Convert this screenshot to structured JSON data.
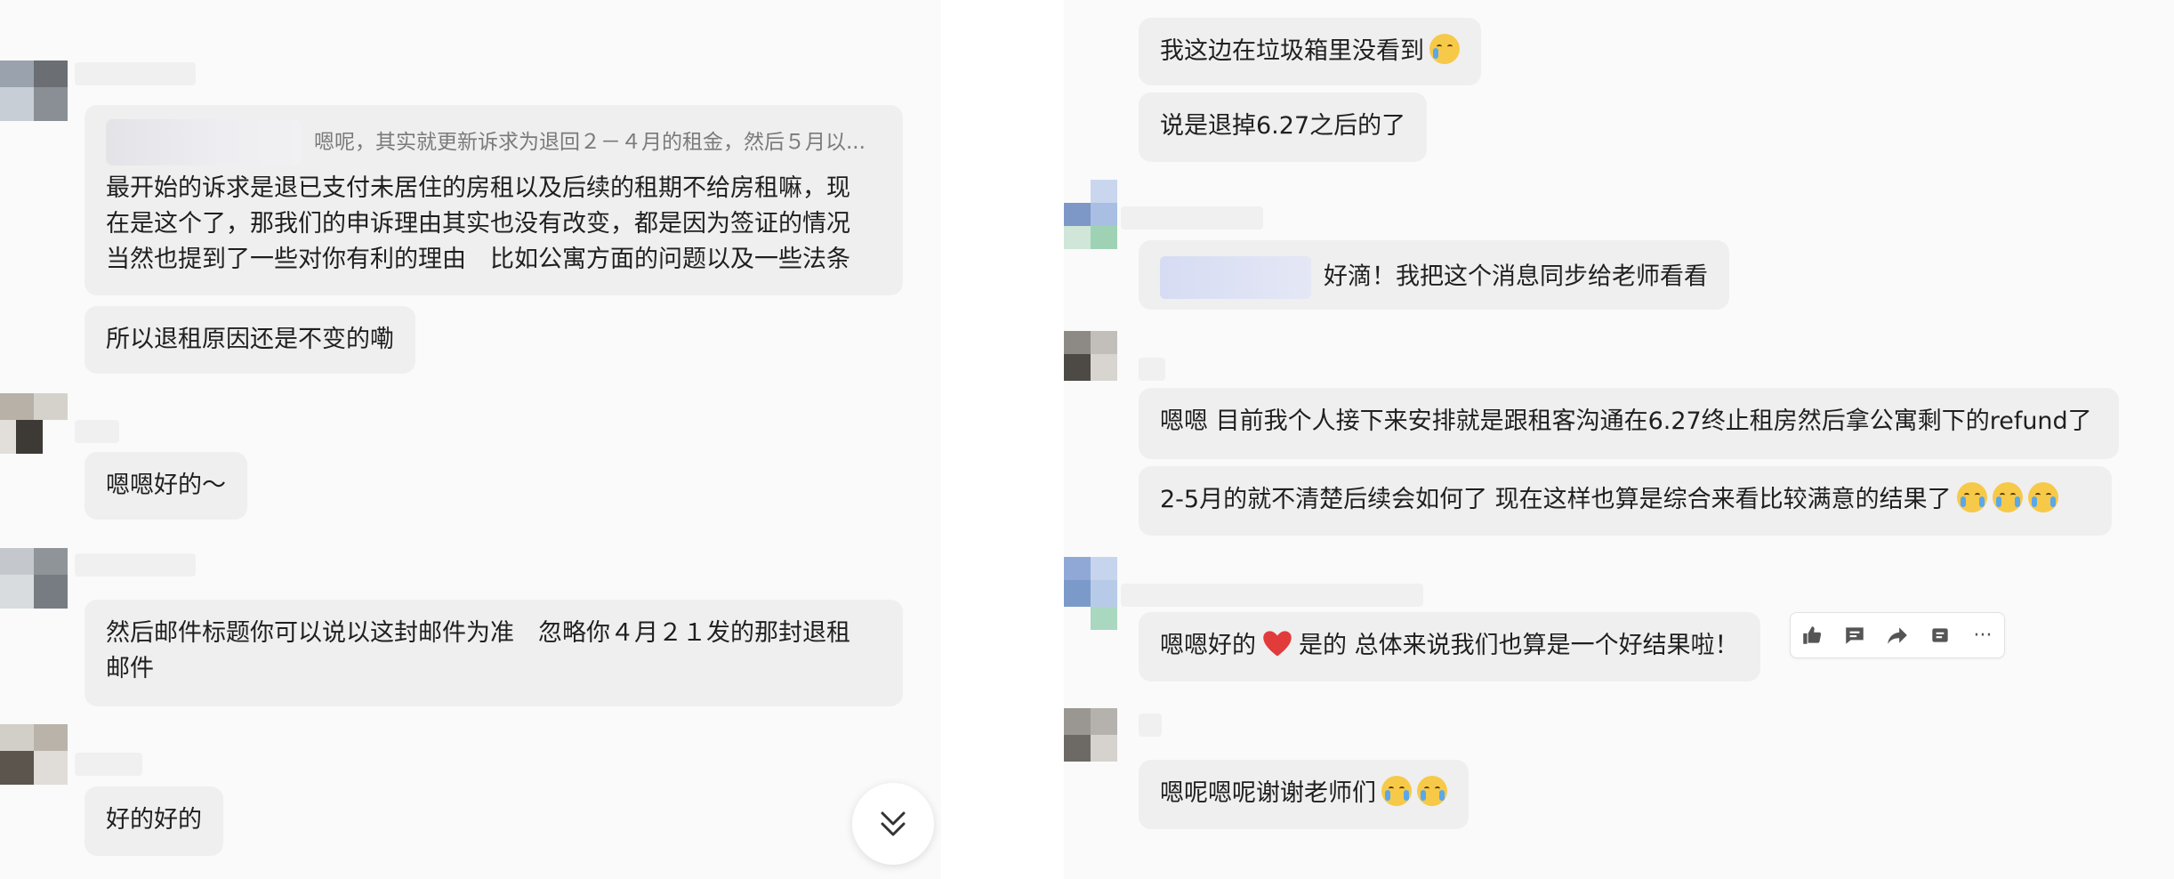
{
  "left": {
    "quote": {
      "text": "嗯呢，其实就更新诉求为退回２－４月的租金，然后５月以..."
    },
    "messages": [
      {
        "lines": [
          "最开始的诉求是退已支付未居住的房租以及后续的租期不给房租嘛，现",
          "在是这个了，那我们的申诉理由其实也没有改变，都是因为签证的情况",
          "当然也提到了一些对你有利的理由　比如公寓方面的问题以及一些法条"
        ]
      },
      {
        "text": "所以退租原因还是不变的嘞"
      },
      {
        "text": "嗯嗯好的～"
      },
      {
        "lines": [
          "然后邮件标题你可以说以这封邮件为准　忽略你４月２１发的那封退租",
          "邮件"
        ]
      },
      {
        "text": "好的好的"
      }
    ]
  },
  "right": {
    "messages": [
      {
        "text": "我这边在垃圾箱里没看到"
      },
      {
        "text": "说是退掉6.27之后的了"
      },
      {
        "text": "好滴！我把这个消息同步给老师看看"
      },
      {
        "text": "嗯嗯 目前我个人接下来安排就是跟租客沟通在6.27终止租房然后拿公寓剩下的refund了"
      },
      {
        "text": "2-5月的就不清楚后续会如何了 现在这样也算是综合来看比较满意的结果了"
      },
      {
        "part1": "嗯嗯好的",
        "part2": "是的 总体来说我们也算是一个好结果啦！"
      },
      {
        "text": "嗯呢嗯呢谢谢老师们"
      }
    ],
    "actions": [
      "thumbs-up",
      "comment",
      "share",
      "archive",
      "more"
    ],
    "more_label": "···"
  },
  "colors": {
    "bubble": "#efefef",
    "page": "#fafafa",
    "heart": "#e23b3b",
    "emoji": "#f7c948"
  }
}
